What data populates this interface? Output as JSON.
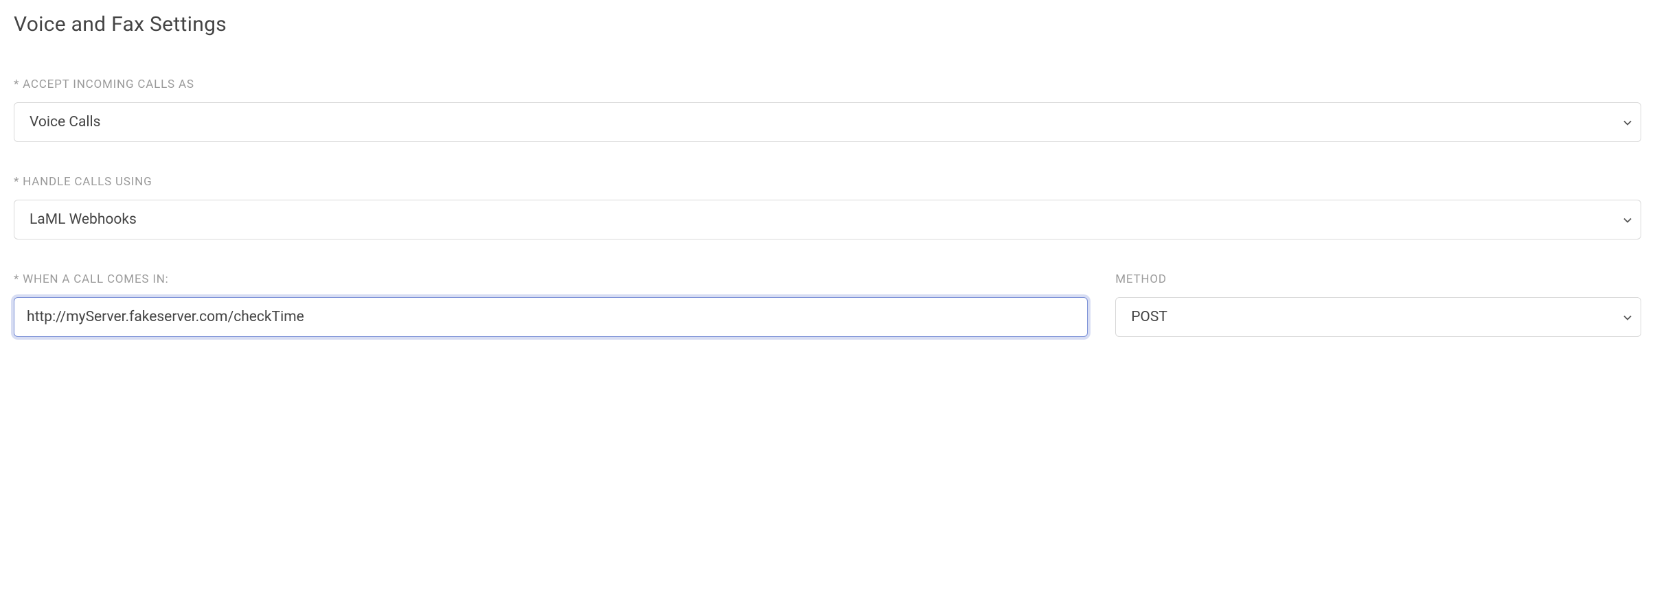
{
  "title": "Voice and Fax Settings",
  "fields": {
    "accept_incoming": {
      "label": "* ACCEPT INCOMING CALLS AS",
      "value": "Voice Calls"
    },
    "handle_calls": {
      "label": "* HANDLE CALLS USING",
      "value": "LaML Webhooks"
    },
    "call_comes_in": {
      "label": "* WHEN A CALL COMES IN:",
      "value": "http://myServer.fakeserver.com/checkTime"
    },
    "method": {
      "label": "METHOD",
      "value": "POST"
    }
  }
}
